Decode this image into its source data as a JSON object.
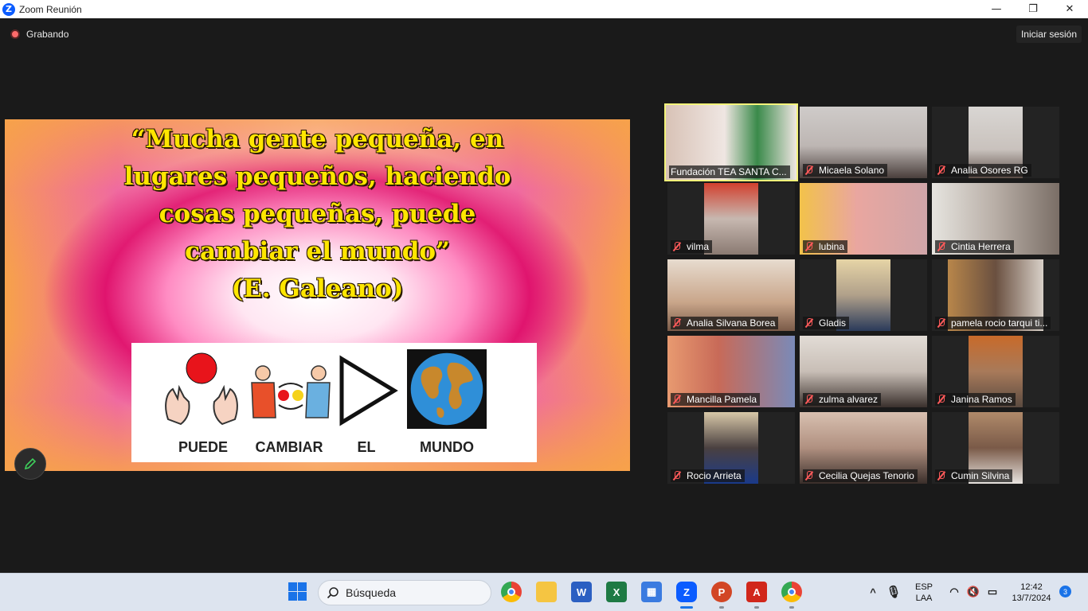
{
  "window": {
    "title": "Zoom Reunión",
    "icon": "zoom-icon",
    "controls": {
      "minimize": "—",
      "restore": "❐",
      "close": "✕"
    }
  },
  "meeting": {
    "recording_label": "Grabando",
    "signin_label": "Iniciar sesión"
  },
  "slide": {
    "quote_lines": [
      "“Mucha gente pequeña, en",
      "lugares pequeños, haciendo",
      "cosas pequeñas, puede",
      "cambiar el mundo”",
      "(E. Galeano)"
    ],
    "pictograms": [
      {
        "label": "PUEDE",
        "icon": "hands-ball-icon"
      },
      {
        "label": "CAMBIAR",
        "icon": "exchange-icon"
      },
      {
        "label": "EL",
        "icon": "play-triangle-icon"
      },
      {
        "label": "MUNDO",
        "icon": "globe-icon"
      }
    ],
    "edit_icon": "pencil-icon"
  },
  "participants": [
    {
      "name": "Fundación TEA SANTA C...",
      "muted": false,
      "active_speaker": true
    },
    {
      "name": "Micaela Solano",
      "muted": true
    },
    {
      "name": "Analia Osores RG",
      "muted": true
    },
    {
      "name": "vilma",
      "muted": true
    },
    {
      "name": "lubina",
      "muted": true
    },
    {
      "name": "Cintia Herrera",
      "muted": true
    },
    {
      "name": "Analia Silvana Borea",
      "muted": true
    },
    {
      "name": "Gladis",
      "muted": true
    },
    {
      "name": "pamela rocio tarqui ti...",
      "muted": true
    },
    {
      "name": "Mancilla Pamela",
      "muted": true
    },
    {
      "name": "zulma alvarez",
      "muted": true
    },
    {
      "name": "Janina Ramos",
      "muted": true
    },
    {
      "name": "Rocio Arrieta",
      "muted": true
    },
    {
      "name": "Cecilia Quejas Tenorio",
      "muted": true
    },
    {
      "name": "Cumin Silvina",
      "muted": true
    }
  ],
  "taskbar": {
    "search_placeholder": "Búsqueda",
    "apps": [
      "windows-start-icon",
      "chrome-icon",
      "file-explorer-icon",
      "word-icon",
      "excel-icon",
      "store-icon",
      "zoom-icon",
      "powerpoint-icon",
      "acrobat-icon",
      "chrome-profile-icon"
    ],
    "language_top": "ESP",
    "language_bottom": "LAA",
    "time": "12:42",
    "date": "13/7/2024",
    "notifications": "3"
  }
}
